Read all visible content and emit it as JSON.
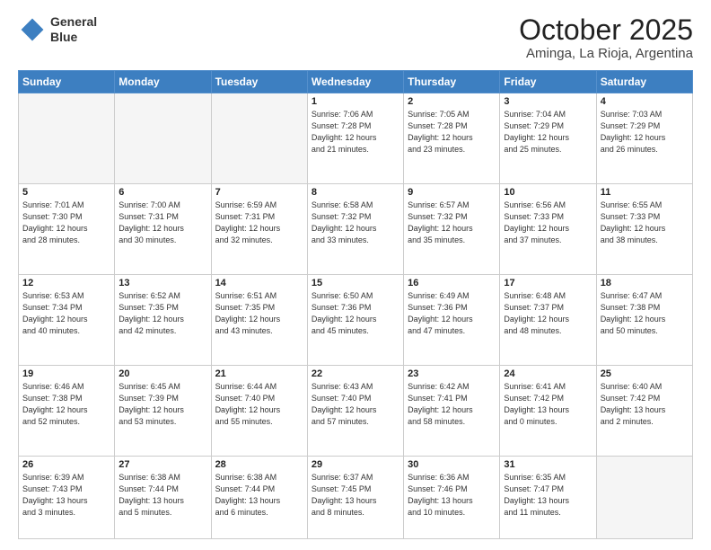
{
  "header": {
    "logo_line1": "General",
    "logo_line2": "Blue",
    "month": "October 2025",
    "location": "Aminga, La Rioja, Argentina"
  },
  "weekdays": [
    "Sunday",
    "Monday",
    "Tuesday",
    "Wednesday",
    "Thursday",
    "Friday",
    "Saturday"
  ],
  "weeks": [
    [
      {
        "day": "",
        "info": ""
      },
      {
        "day": "",
        "info": ""
      },
      {
        "day": "",
        "info": ""
      },
      {
        "day": "1",
        "info": "Sunrise: 7:06 AM\nSunset: 7:28 PM\nDaylight: 12 hours\nand 21 minutes."
      },
      {
        "day": "2",
        "info": "Sunrise: 7:05 AM\nSunset: 7:28 PM\nDaylight: 12 hours\nand 23 minutes."
      },
      {
        "day": "3",
        "info": "Sunrise: 7:04 AM\nSunset: 7:29 PM\nDaylight: 12 hours\nand 25 minutes."
      },
      {
        "day": "4",
        "info": "Sunrise: 7:03 AM\nSunset: 7:29 PM\nDaylight: 12 hours\nand 26 minutes."
      }
    ],
    [
      {
        "day": "5",
        "info": "Sunrise: 7:01 AM\nSunset: 7:30 PM\nDaylight: 12 hours\nand 28 minutes."
      },
      {
        "day": "6",
        "info": "Sunrise: 7:00 AM\nSunset: 7:31 PM\nDaylight: 12 hours\nand 30 minutes."
      },
      {
        "day": "7",
        "info": "Sunrise: 6:59 AM\nSunset: 7:31 PM\nDaylight: 12 hours\nand 32 minutes."
      },
      {
        "day": "8",
        "info": "Sunrise: 6:58 AM\nSunset: 7:32 PM\nDaylight: 12 hours\nand 33 minutes."
      },
      {
        "day": "9",
        "info": "Sunrise: 6:57 AM\nSunset: 7:32 PM\nDaylight: 12 hours\nand 35 minutes."
      },
      {
        "day": "10",
        "info": "Sunrise: 6:56 AM\nSunset: 7:33 PM\nDaylight: 12 hours\nand 37 minutes."
      },
      {
        "day": "11",
        "info": "Sunrise: 6:55 AM\nSunset: 7:33 PM\nDaylight: 12 hours\nand 38 minutes."
      }
    ],
    [
      {
        "day": "12",
        "info": "Sunrise: 6:53 AM\nSunset: 7:34 PM\nDaylight: 12 hours\nand 40 minutes."
      },
      {
        "day": "13",
        "info": "Sunrise: 6:52 AM\nSunset: 7:35 PM\nDaylight: 12 hours\nand 42 minutes."
      },
      {
        "day": "14",
        "info": "Sunrise: 6:51 AM\nSunset: 7:35 PM\nDaylight: 12 hours\nand 43 minutes."
      },
      {
        "day": "15",
        "info": "Sunrise: 6:50 AM\nSunset: 7:36 PM\nDaylight: 12 hours\nand 45 minutes."
      },
      {
        "day": "16",
        "info": "Sunrise: 6:49 AM\nSunset: 7:36 PM\nDaylight: 12 hours\nand 47 minutes."
      },
      {
        "day": "17",
        "info": "Sunrise: 6:48 AM\nSunset: 7:37 PM\nDaylight: 12 hours\nand 48 minutes."
      },
      {
        "day": "18",
        "info": "Sunrise: 6:47 AM\nSunset: 7:38 PM\nDaylight: 12 hours\nand 50 minutes."
      }
    ],
    [
      {
        "day": "19",
        "info": "Sunrise: 6:46 AM\nSunset: 7:38 PM\nDaylight: 12 hours\nand 52 minutes."
      },
      {
        "day": "20",
        "info": "Sunrise: 6:45 AM\nSunset: 7:39 PM\nDaylight: 12 hours\nand 53 minutes."
      },
      {
        "day": "21",
        "info": "Sunrise: 6:44 AM\nSunset: 7:40 PM\nDaylight: 12 hours\nand 55 minutes."
      },
      {
        "day": "22",
        "info": "Sunrise: 6:43 AM\nSunset: 7:40 PM\nDaylight: 12 hours\nand 57 minutes."
      },
      {
        "day": "23",
        "info": "Sunrise: 6:42 AM\nSunset: 7:41 PM\nDaylight: 12 hours\nand 58 minutes."
      },
      {
        "day": "24",
        "info": "Sunrise: 6:41 AM\nSunset: 7:42 PM\nDaylight: 13 hours\nand 0 minutes."
      },
      {
        "day": "25",
        "info": "Sunrise: 6:40 AM\nSunset: 7:42 PM\nDaylight: 13 hours\nand 2 minutes."
      }
    ],
    [
      {
        "day": "26",
        "info": "Sunrise: 6:39 AM\nSunset: 7:43 PM\nDaylight: 13 hours\nand 3 minutes."
      },
      {
        "day": "27",
        "info": "Sunrise: 6:38 AM\nSunset: 7:44 PM\nDaylight: 13 hours\nand 5 minutes."
      },
      {
        "day": "28",
        "info": "Sunrise: 6:38 AM\nSunset: 7:44 PM\nDaylight: 13 hours\nand 6 minutes."
      },
      {
        "day": "29",
        "info": "Sunrise: 6:37 AM\nSunset: 7:45 PM\nDaylight: 13 hours\nand 8 minutes."
      },
      {
        "day": "30",
        "info": "Sunrise: 6:36 AM\nSunset: 7:46 PM\nDaylight: 13 hours\nand 10 minutes."
      },
      {
        "day": "31",
        "info": "Sunrise: 6:35 AM\nSunset: 7:47 PM\nDaylight: 13 hours\nand 11 minutes."
      },
      {
        "day": "",
        "info": ""
      }
    ]
  ]
}
